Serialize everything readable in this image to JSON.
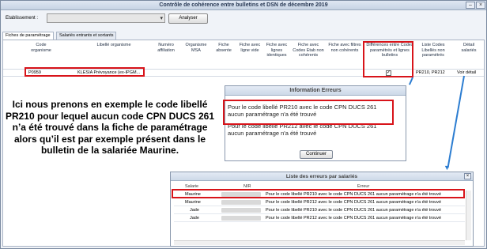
{
  "window": {
    "title": "Contrôle de cohérence entre bulletins et DSN de décembre 2019"
  },
  "toolbar": {
    "etablissement_label": "Etablissement :",
    "etablissement_value": "",
    "analyser_label": "Analyser"
  },
  "tabs": [
    {
      "label": "Fiches de paramétrage",
      "active": true
    },
    {
      "label": "Salariés entrants et sortants",
      "active": false
    }
  ],
  "grid": {
    "columns": [
      "Code organisme",
      "Libellé organisme",
      "Numéro affiliation",
      "Organisme MSA",
      "Fiche absente",
      "Fiche avec ligne vide",
      "Fiche avec lignes identiques",
      "Fiche avec Codes Etab non cohérents",
      "Fiche avec filtres non cohérents",
      "Différences entre Codes paramétrés et lignes bulletins",
      "Liste Codes Libellés non paramétrés",
      "Détail salariés"
    ],
    "row": {
      "code": "P0959",
      "libelle": "KLESIA Prévoyance (ex-IPGM...",
      "differences_checked": true,
      "liste_codes": "PR210, PR212",
      "detail": "Voir détail"
    }
  },
  "annotation": "Ici nous prenons en exemple le code libellé PR210 pour lequel aucun code CPN DUCS 261 n’a été trouvé dans la fiche de paramétrage alors qu’il est par exemple présent dans le bulletin de la salariée Maurine.",
  "info_dialog": {
    "title": "Information Erreurs",
    "message1": "Pour le code libellé PR210 avec le code CPN DUCS 261 aucun paramétrage n'a été trouvé",
    "message2": "Pour le code libellé PR212 avec le code CPN DUCS 261 aucun paramétrage n'a été trouvé",
    "button": "Continuer"
  },
  "errors_dialog": {
    "title": "Liste des erreurs par salariés",
    "columns": [
      "Salarie",
      "NIR",
      "Erreur"
    ],
    "rows": [
      {
        "salarie": "Maurine",
        "erreur": "Pour le code libellé PR210 avec le code CPN DUCS 261 aucun paramétrage n'a été trouvé"
      },
      {
        "salarie": "Maurine",
        "erreur": "Pour le code libellé PR212 avec le code CPN DUCS 261 aucun paramétrage n'a été trouvé"
      },
      {
        "salarie": "Jade",
        "erreur": "Pour le code libellé PR210 avec le code CPN DUCS 261 aucun paramétrage n'a été trouvé"
      },
      {
        "salarie": "Jade",
        "erreur": "Pour le code libellé PR212 avec le code CPN DUCS 261 aucun paramétrage n'a été trouvé"
      }
    ]
  },
  "colors": {
    "highlight": "#d8141a",
    "connector": "#2c7dd1"
  }
}
